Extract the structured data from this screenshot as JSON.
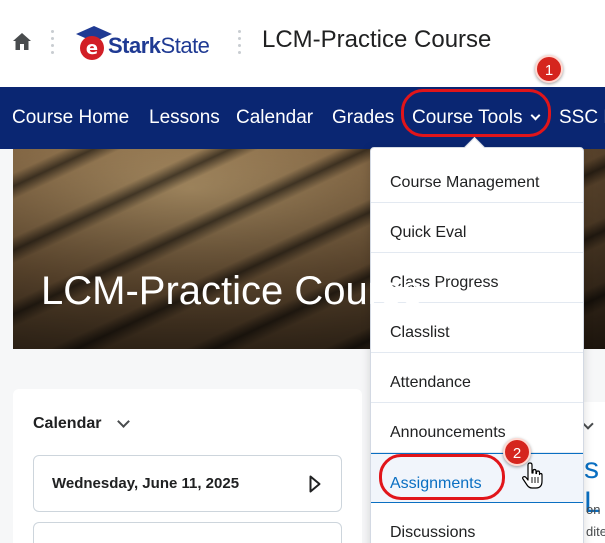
{
  "header": {
    "logo_e": "e",
    "logo_stark": "Stark",
    "logo_state": "State",
    "course_title": "LCM-Practice Course"
  },
  "nav": {
    "items": [
      {
        "label": "Course Home"
      },
      {
        "label": "Lessons"
      },
      {
        "label": "Calendar"
      },
      {
        "label": "Grades"
      },
      {
        "label": "Course Tools"
      },
      {
        "label": "SSC R"
      }
    ]
  },
  "banner": {
    "title": "LCM-Practice Course"
  },
  "calendar_widget": {
    "title": "Calendar",
    "date": "Wednesday, June 11, 2025"
  },
  "right_widget": {
    "big_text": "s L",
    "line1": "on",
    "line2": "dite"
  },
  "dropdown": {
    "items": [
      {
        "label": "Course Management"
      },
      {
        "label": "Quick Eval"
      },
      {
        "label": "Class Progress"
      },
      {
        "label": "Classlist"
      },
      {
        "label": "Attendance"
      },
      {
        "label": "Announcements"
      },
      {
        "label": "Assignments"
      },
      {
        "label": "Discussions"
      }
    ]
  },
  "annotations": {
    "step1": "1",
    "step2": "2"
  },
  "colors": {
    "nav_bg": "#0a2672",
    "highlight": "#e1151a",
    "link": "#0a6fc2"
  }
}
